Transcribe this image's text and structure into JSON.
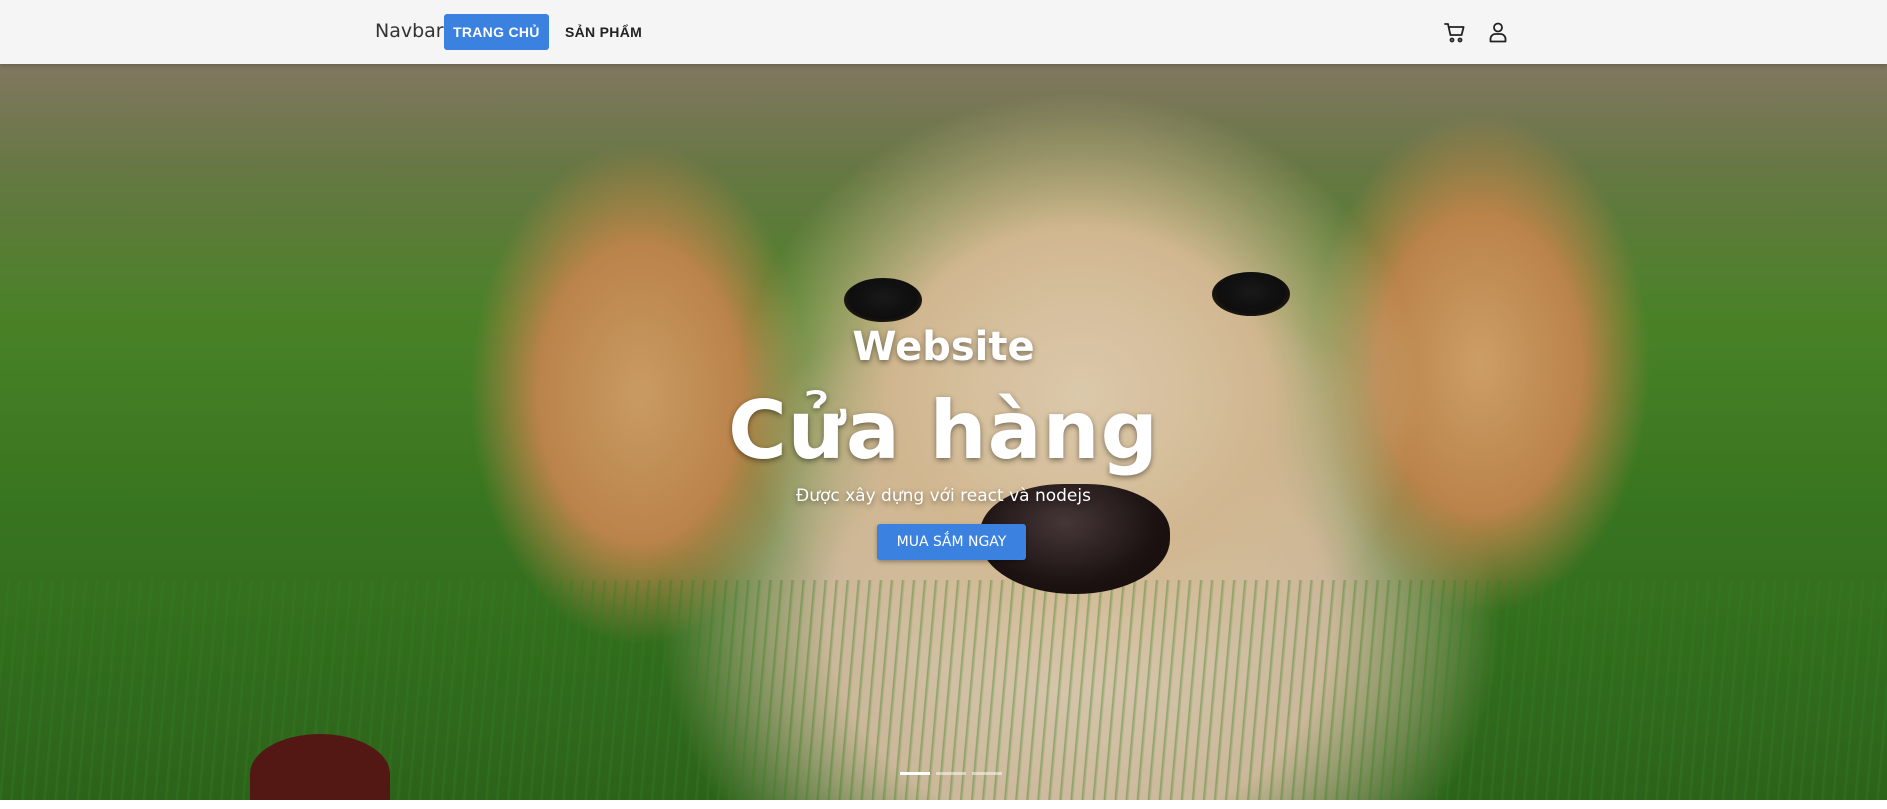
{
  "navbar": {
    "brand": "Navbar",
    "links": [
      {
        "label": "TRANG CHỦ",
        "active": true
      },
      {
        "label": "SẢN PHẨM",
        "active": false
      }
    ],
    "icons": [
      "cart-icon",
      "user-icon"
    ]
  },
  "hero": {
    "subtitle": "Website",
    "title": "Cửa hàng",
    "description": "Được xây dựng với react và nodejs",
    "cta_label": "MUA SẮM NGAY",
    "slides_total": 3,
    "active_slide": 1
  },
  "colors": {
    "accent": "#3a81e0",
    "navbar_bg": "#f5f5f5"
  }
}
